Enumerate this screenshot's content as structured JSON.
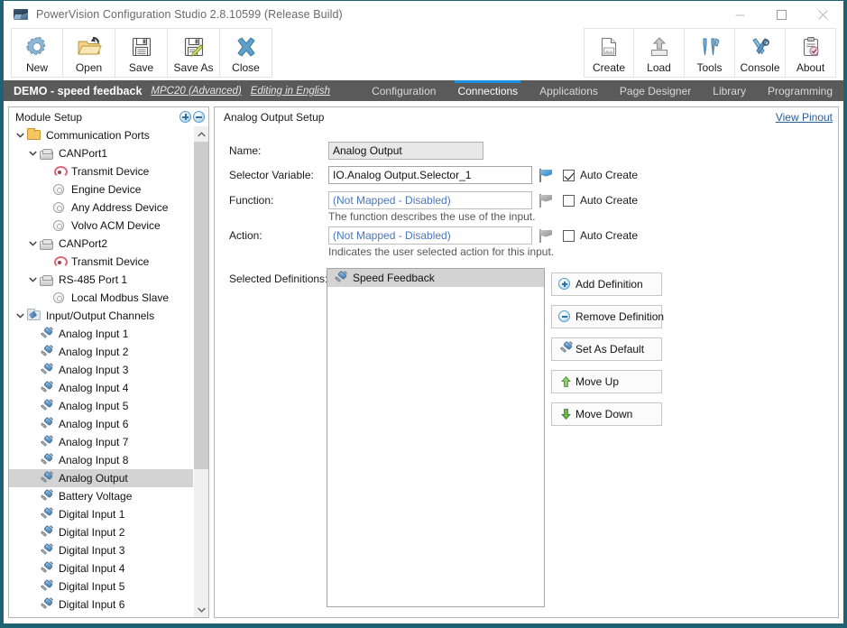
{
  "window": {
    "title": "PowerVision Configuration Studio 2.8.10599 (Release Build)",
    "app_icon": "app-icon",
    "minimize": "–",
    "maximize": "□",
    "close": "✕",
    "border_color": "#1d6373"
  },
  "toolbar": {
    "left": [
      {
        "label": "New",
        "icon": "gear-icon"
      },
      {
        "label": "Open",
        "icon": "folder-open-icon"
      },
      {
        "label": "Save",
        "icon": "floppy-disk-icon"
      },
      {
        "label": "Save As",
        "icon": "floppy-disk-pencil-icon"
      },
      {
        "label": "Close",
        "icon": "x-cross-icon"
      }
    ],
    "right": [
      {
        "label": "Create",
        "icon": "document-create-icon"
      },
      {
        "label": "Load",
        "icon": "upload-arrow-icon"
      },
      {
        "label": "Tools",
        "icon": "screwdriver-wrench-icon"
      },
      {
        "label": "Console",
        "icon": "wrench-cross-icon"
      },
      {
        "label": "About",
        "icon": "clipboard-check-icon"
      }
    ]
  },
  "navbar": {
    "project_name": "DEMO - speed feedback",
    "device_link": "MPC20 (Advanced)",
    "language_link": "Editing in English",
    "accent_color": "#1e90e0",
    "background": "#5a5a5a",
    "tabs": [
      {
        "label": "Configuration",
        "active": false
      },
      {
        "label": "Connections",
        "active": true
      },
      {
        "label": "Applications",
        "active": false
      },
      {
        "label": "Page Designer",
        "active": false
      },
      {
        "label": "Library",
        "active": false
      },
      {
        "label": "Programming",
        "active": false
      }
    ]
  },
  "tree": {
    "header": "Module Setup",
    "expand_all_button": "expand-all",
    "collapse_all_button": "collapse-all",
    "items": [
      {
        "label": "Communication Ports",
        "indent": 0,
        "twisty": "down",
        "icon": "folder-icon",
        "selected": false
      },
      {
        "label": "CANPort1",
        "indent": 1,
        "twisty": "down",
        "icon": "port-icon",
        "selected": false
      },
      {
        "label": "Transmit Device",
        "indent": 2,
        "twisty": "none",
        "icon": "transmit-icon",
        "selected": false
      },
      {
        "label": "Engine Device",
        "indent": 2,
        "twisty": "none",
        "icon": "gear-icon",
        "selected": false
      },
      {
        "label": "Any Address Device",
        "indent": 2,
        "twisty": "none",
        "icon": "gear-icon",
        "selected": false
      },
      {
        "label": "Volvo ACM Device",
        "indent": 2,
        "twisty": "none",
        "icon": "gear-icon",
        "selected": false
      },
      {
        "label": "CANPort2",
        "indent": 1,
        "twisty": "down",
        "icon": "port-icon",
        "selected": false
      },
      {
        "label": "Transmit Device",
        "indent": 2,
        "twisty": "none",
        "icon": "transmit-icon",
        "selected": false
      },
      {
        "label": "RS-485 Port 1",
        "indent": 1,
        "twisty": "down",
        "icon": "port-icon",
        "selected": false
      },
      {
        "label": "Local Modbus Slave",
        "indent": 2,
        "twisty": "none",
        "icon": "gear-icon",
        "selected": false
      },
      {
        "label": "Input/Output Channels",
        "indent": 0,
        "twisty": "down",
        "icon": "io-folder-icon",
        "selected": false
      },
      {
        "label": "Analog Input 1",
        "indent": 1,
        "twisty": "none",
        "icon": "plug-icon",
        "selected": false
      },
      {
        "label": "Analog Input 2",
        "indent": 1,
        "twisty": "none",
        "icon": "plug-icon",
        "selected": false
      },
      {
        "label": "Analog Input 3",
        "indent": 1,
        "twisty": "none",
        "icon": "plug-icon",
        "selected": false
      },
      {
        "label": "Analog Input 4",
        "indent": 1,
        "twisty": "none",
        "icon": "plug-icon",
        "selected": false
      },
      {
        "label": "Analog Input 5",
        "indent": 1,
        "twisty": "none",
        "icon": "plug-icon",
        "selected": false
      },
      {
        "label": "Analog Input 6",
        "indent": 1,
        "twisty": "none",
        "icon": "plug-icon",
        "selected": false
      },
      {
        "label": "Analog Input 7",
        "indent": 1,
        "twisty": "none",
        "icon": "plug-icon",
        "selected": false
      },
      {
        "label": "Analog Input 8",
        "indent": 1,
        "twisty": "none",
        "icon": "plug-icon",
        "selected": false
      },
      {
        "label": "Analog Output",
        "indent": 1,
        "twisty": "none",
        "icon": "plug-icon",
        "selected": true
      },
      {
        "label": "Battery Voltage",
        "indent": 1,
        "twisty": "none",
        "icon": "plug-icon",
        "selected": false
      },
      {
        "label": "Digital Input 1",
        "indent": 1,
        "twisty": "none",
        "icon": "plug-icon",
        "selected": false
      },
      {
        "label": "Digital Input 2",
        "indent": 1,
        "twisty": "none",
        "icon": "plug-icon",
        "selected": false
      },
      {
        "label": "Digital Input 3",
        "indent": 1,
        "twisty": "none",
        "icon": "plug-icon",
        "selected": false
      },
      {
        "label": "Digital Input 4",
        "indent": 1,
        "twisty": "none",
        "icon": "plug-icon",
        "selected": false
      },
      {
        "label": "Digital Input 5",
        "indent": 1,
        "twisty": "none",
        "icon": "plug-icon",
        "selected": false
      },
      {
        "label": "Digital Input 6",
        "indent": 1,
        "twisty": "none",
        "icon": "plug-icon",
        "selected": false
      }
    ]
  },
  "content": {
    "title": "Analog Output Setup",
    "view_pinout_link": "View Pinout",
    "fields": {
      "name_label": "Name:",
      "name_value": "Analog Output",
      "selector_label": "Selector Variable:",
      "selector_value": "IO.Analog Output.Selector_1",
      "selector_auto_create": "Auto Create",
      "function_label": "Function:",
      "function_value": "(Not Mapped - Disabled)",
      "function_helper": "The function describes the use of the input.",
      "function_auto_create": "Auto Create",
      "action_label": "Action:",
      "action_value": "(Not Mapped - Disabled)",
      "action_helper": "Indicates the user selected action for this input.",
      "action_auto_create": "Auto Create"
    },
    "definitions": {
      "label": "Selected Definitions:",
      "items": [
        {
          "label": "Speed Feedback",
          "icon": "plug-icon",
          "selected": true
        }
      ],
      "buttons": [
        {
          "label": "Add Definition",
          "icon": "plus-circle-icon"
        },
        {
          "label": "Remove Definition",
          "icon": "minus-circle-icon"
        },
        {
          "label": "Set As Default",
          "icon": "plug-icon"
        },
        {
          "label": "Move Up",
          "icon": "arrow-up-icon"
        },
        {
          "label": "Move Down",
          "icon": "arrow-down-icon"
        }
      ]
    }
  }
}
